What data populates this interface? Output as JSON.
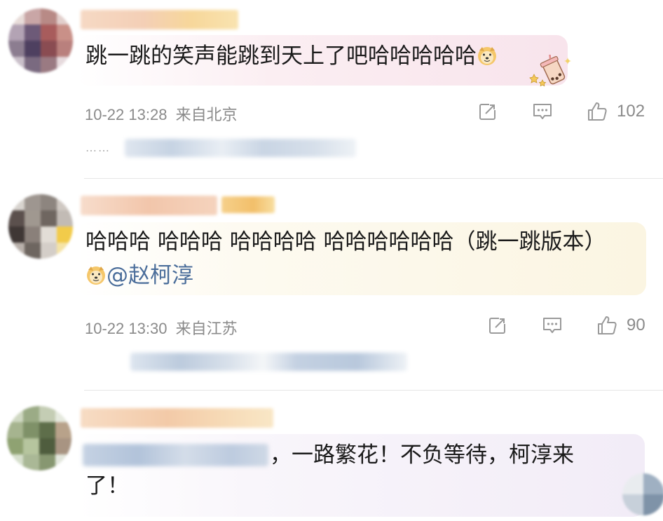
{
  "comments": [
    {
      "text": "跳一跳的笑声能跳到天上了吧哈哈哈哈哈",
      "emoji": "doge-emoji",
      "date": "10-22 13:28",
      "location": "来自北京",
      "likes": "102"
    },
    {
      "text_line1": "哈哈哈 哈哈哈 哈哈哈哈 哈哈哈哈哈哈（跳一跳版本）",
      "emoji": "doge-emoji",
      "mention": "@赵柯淳",
      "date": "10-22 13:30",
      "location": "来自江苏",
      "likes": "90"
    },
    {
      "text_line1": "，一路繁花！不负等待，柯淳来",
      "text_line2": "了！"
    }
  ],
  "reply_preview_ellipsis": "……",
  "icons": [
    "share-icon",
    "comment-icon",
    "like-icon"
  ],
  "colors": {
    "meta_gray": "#8a8a8a",
    "mention_blue": "#4a6d9a",
    "bubble_pink": "#fbe9ef",
    "bubble_yellow": "#fbf6e4",
    "bubble_lavender": "#f3eef8"
  }
}
